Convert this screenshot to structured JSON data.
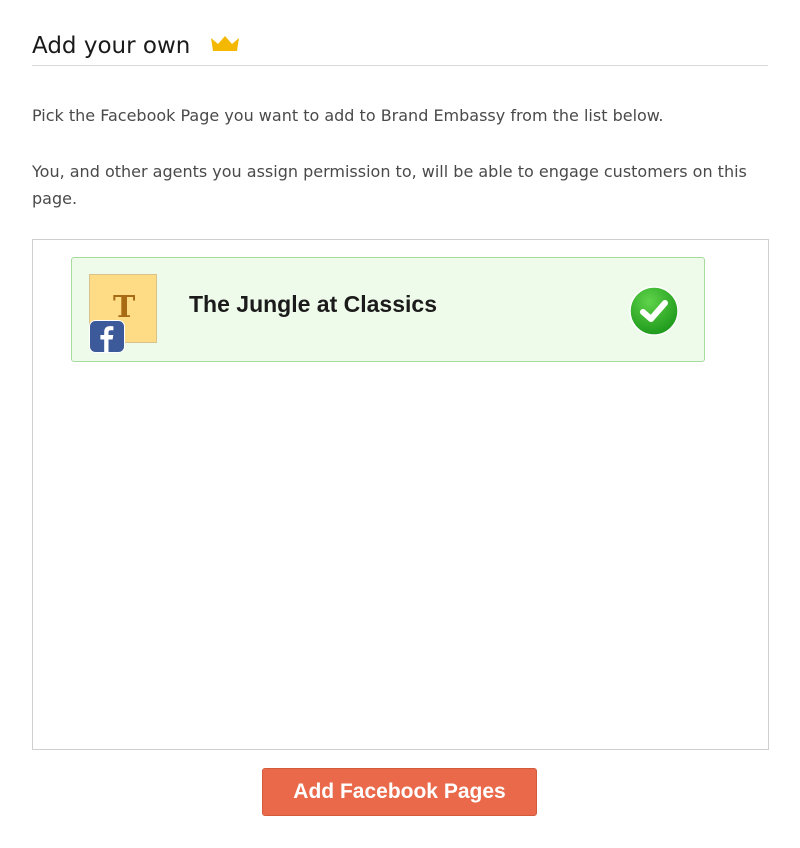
{
  "section": {
    "title": "Add your own",
    "title_icon": "crown-icon",
    "crown_color": "#f5b800"
  },
  "instructions": {
    "line1": "Pick the Facebook Page you want to add to Brand Embassy from the list below.",
    "line2": "You, and other agents you assign permission to, will be able to engage customers on this page."
  },
  "pages_list": {
    "items": [
      {
        "name": "The Jungle at Classics",
        "avatar_letter": "T",
        "avatar_color": "#fedb85",
        "network_icon": "facebook-icon",
        "selected": true,
        "status_icon": "checkmark-icon"
      }
    ]
  },
  "actions": {
    "add_button_label": "Add Facebook Pages",
    "accent_color": "#e9694a"
  }
}
